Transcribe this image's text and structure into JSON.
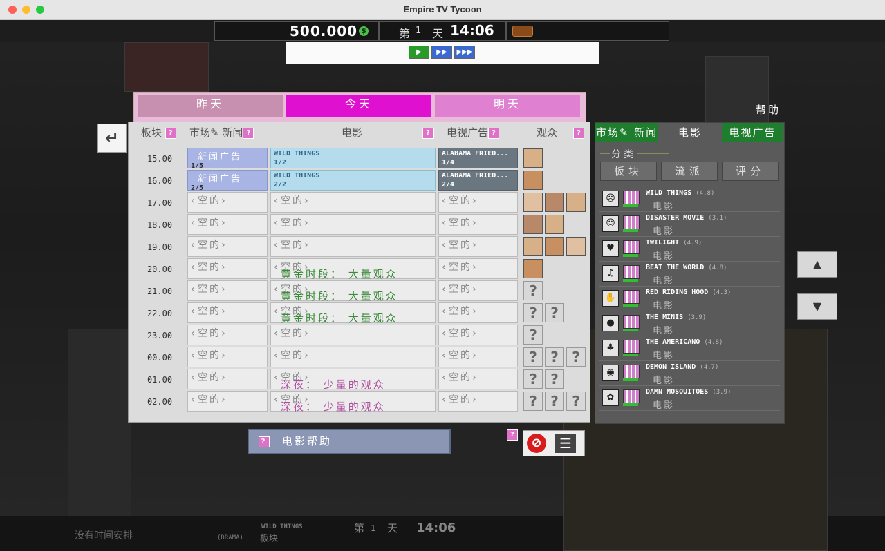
{
  "window": {
    "title": "Empire TV Tycoon"
  },
  "hud": {
    "money": "500.000",
    "money_icon": "coin-icon",
    "day_prefix": "第",
    "day_number": "1",
    "day_suffix": "天",
    "clock": "14:06"
  },
  "playback": {
    "buttons": [
      "▶",
      "▶▶",
      "▶▶▶"
    ]
  },
  "day_tabs": {
    "yesterday": "昨天",
    "today": "今天",
    "tomorrow": "明天"
  },
  "help_label": "帮助",
  "columns": {
    "slot": "板块",
    "market_news": "市场✎ 新闻",
    "movie": "电影",
    "tv_ad": "电视广告",
    "audience": "观众"
  },
  "empty_label": "空的",
  "times": [
    "15.00",
    "16.00",
    "17.00",
    "18.00",
    "19.00",
    "20.00",
    "21.00",
    "22.00",
    "23.00",
    "00.00",
    "01.00",
    "02.00"
  ],
  "schedule": {
    "news": [
      {
        "title": "新闻广告",
        "part": "1/5"
      },
      {
        "title": "新闻广告",
        "part": "2/5"
      }
    ],
    "movie": [
      {
        "title": "WILD THINGS",
        "part": "1/2"
      },
      {
        "title": "WILD THINGS",
        "part": "2/2"
      }
    ],
    "ad": [
      {
        "title": "ALABAMA FRIED...",
        "part": "1/4"
      },
      {
        "title": "ALABAMA FRIED...",
        "part": "2/4"
      }
    ]
  },
  "annotations": {
    "prime_time": "黄金时段： 大量观众",
    "late_night": "深夜： 少量的观众"
  },
  "movie_help": "电影帮助",
  "right_panel": {
    "tabs": [
      "市场✎ 新闻",
      "电影",
      "电视广告"
    ],
    "category_label": "分类",
    "filters": [
      "板块",
      "流派",
      "评分"
    ],
    "movies": [
      {
        "title": "WILD THINGS",
        "rating": "(4.8)",
        "kind": "电影",
        "icon": "frown-face-icon",
        "glyph": "☹"
      },
      {
        "title": "DISASTER MOVIE",
        "rating": "(3.1)",
        "kind": "电影",
        "icon": "smile-face-icon",
        "glyph": "☺"
      },
      {
        "title": "TWILIGHT",
        "rating": "(4.9)",
        "kind": "电影",
        "icon": "heart-icon",
        "glyph": "♥"
      },
      {
        "title": "BEAT THE WORLD",
        "rating": "(4.8)",
        "kind": "电影",
        "icon": "music-note-icon",
        "glyph": "♫"
      },
      {
        "title": "RED RIDING HOOD",
        "rating": "(4.3)",
        "kind": "电影",
        "icon": "hand-icon",
        "glyph": "✋"
      },
      {
        "title": "THE MINIS",
        "rating": "(3.9)",
        "kind": "电影",
        "icon": "coin-icon",
        "glyph": "●"
      },
      {
        "title": "THE AMERICANO",
        "rating": "(4.8)",
        "kind": "电影",
        "icon": "cactus-icon",
        "glyph": "♣"
      },
      {
        "title": "DEMON ISLAND",
        "rating": "(4.7)",
        "kind": "电影",
        "icon": "ear-icon",
        "glyph": "◉"
      },
      {
        "title": "DAMN MOSQUITOES",
        "rating": "(3.9)",
        "kind": "电影",
        "icon": "paw-icon",
        "glyph": "✿"
      }
    ]
  },
  "bottom_scene": {
    "day_prefix": "第",
    "day_number": "1",
    "day_suffix": "天",
    "clock": "14:06",
    "genre": "(DRAMA)",
    "show": "WILD THINGS",
    "slot": "板块",
    "no_schedule": "没有时间安排"
  },
  "colors": {
    "today_tab": "#e010d0",
    "yesterday_tab": "#c890b0",
    "tomorrow_tab": "#e080d0",
    "prime_text": "#3b8a3b",
    "late_text": "#b050a0",
    "green_tab": "#1e7e2e"
  }
}
